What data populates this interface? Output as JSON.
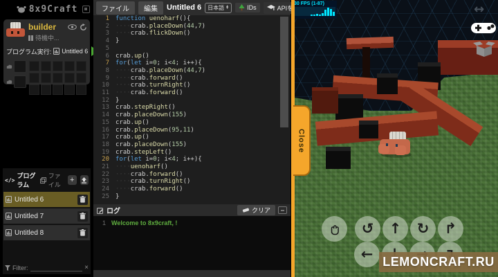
{
  "colors": {
    "accent": "#f5a62b",
    "selected-olive": "#695d24",
    "gold": "#dcb93f",
    "log-green": "#5fae3f",
    "kw-blue": "#569cd6",
    "num-green": "#b5cea8",
    "fn-yellow": "#dcdcaa"
  },
  "logo": {
    "title": "8x9Craft"
  },
  "sidebar": {
    "character": {
      "name": "builder",
      "status": "待機中..."
    },
    "run_row": {
      "label": "プログラム実行:",
      "program": "Untitled 6"
    },
    "inventory": {
      "equipment_slots": 2,
      "grid_cols": 5,
      "grid_rows": 3
    },
    "programs_panel": {
      "tabs": [
        {
          "label": "プログラム"
        },
        {
          "label": "ファイル"
        }
      ],
      "add_label": "+",
      "code_tab_glyph": "</>",
      "items": [
        {
          "name": "Untitled 6",
          "selected": true
        },
        {
          "name": "Untitled 7",
          "selected": false
        },
        {
          "name": "Untitled 8",
          "selected": false
        }
      ],
      "filter_label": "Filter:",
      "clear_filter_glyph": "×"
    }
  },
  "menubar": {
    "file": "ファイル",
    "edit": "編集",
    "title": "Untitled 6",
    "language": "日本語",
    "ids_label": "IDs",
    "learn_api_label": "APIを学ぶ"
  },
  "editor": {
    "lines": [
      "function uenoharf(){",
      "    crab.placeDown(44,7)",
      "    crab.flickDown()",
      "}",
      "",
      "crab.up()",
      "for(let i=0; i<4; i++){",
      "    crab.placeDown(44,7)",
      "    crab.forward()",
      "    crab.turnRight()",
      "    crab.forward()",
      "}",
      "crab.stepRight()",
      "crab.placeDown(155)",
      "crab.up()",
      "crab.placeDown(95,11)",
      "crab.up()",
      "crab.placeDown(155)",
      "crab.stepLeft()",
      "for(let i=0; i<4; i++){",
      "    uenoharf()",
      "    crab.forward()",
      "    crab.turnRight()",
      "    crab.forward()",
      "}"
    ],
    "gold_line_numbers": [
      1,
      7,
      20
    ]
  },
  "log": {
    "title": "ログ",
    "clear_label": "クリア",
    "entries": [
      {
        "num": "1",
        "text": "Welcome to 8x9craft, !"
      }
    ]
  },
  "game": {
    "fps_text": "30 FPS (1-87)",
    "fps_graph": [
      2,
      2,
      3,
      2,
      4,
      9,
      12,
      10,
      6,
      3
    ],
    "resize_glyph": "↔",
    "close_label": "Close",
    "watermark": "LEMONCRAFT.RU",
    "controls": {
      "row1": [
        {
          "name": "grab-hand",
          "glyph": ""
        },
        {
          "name": "rotate-left",
          "glyph": "↺"
        },
        {
          "name": "move-forward",
          "glyph": "↑"
        },
        {
          "name": "rotate-right",
          "glyph": "↻"
        },
        {
          "name": "step-up",
          "glyph": "↱"
        }
      ],
      "row2": [
        {
          "name": "move-left",
          "glyph": "←"
        },
        {
          "name": "move-back",
          "glyph": "↓"
        },
        {
          "name": "move-right",
          "glyph": "→"
        },
        {
          "name": "step-down",
          "glyph": "↴"
        }
      ]
    }
  }
}
